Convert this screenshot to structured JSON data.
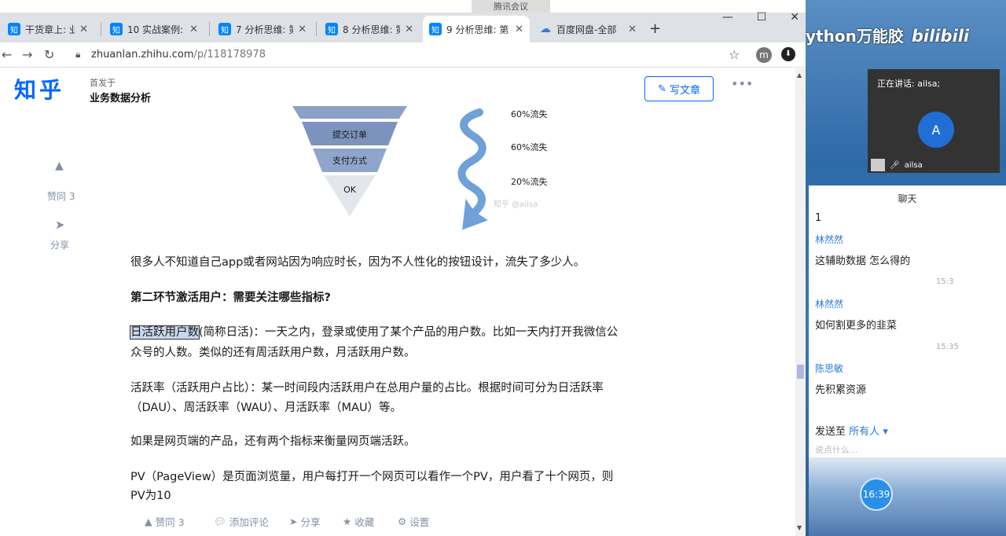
{
  "meeting": {
    "window_title": "腾讯会议"
  },
  "watermark": {
    "brand_left": "Python万能胶",
    "brand_right": "bilibili"
  },
  "tabs": [
    {
      "favicon": "知",
      "title": "干货章上: 业"
    },
    {
      "favicon": "知",
      "title": "10 实战案例:"
    },
    {
      "favicon": "知",
      "title": "7 分析思维: 第"
    },
    {
      "favicon": "知",
      "title": "8 分析思维: 第"
    },
    {
      "favicon": "知",
      "title": "9 分析思维: 第"
    },
    {
      "favicon": "cloud",
      "title": "百度网盘-全部"
    }
  ],
  "browser": {
    "url_host": "zhuanlan.zhihu.com",
    "url_path": "/p/118178978",
    "profile_initial": "m"
  },
  "page": {
    "logo": "知乎",
    "pub_label": "首发于",
    "pub_name": "业务数据分析",
    "write_label": "写文章",
    "side_like": "赞同 3",
    "side_share": "分享",
    "funnel": {
      "levels": [
        "提交订单",
        "支付方式",
        "OK"
      ],
      "losses": [
        "60%流失",
        "60%流失",
        "20%流失"
      ],
      "watermark": "知乎 @ailsa"
    },
    "paragraphs": {
      "p1": "很多人不知道自己app或者网站因为响应时长，因为不人性化的按钮设计，流失了多少人。",
      "h2": "第二环节激活用户：需要关注哪些指标?",
      "p2_hl": "日活跃用户数",
      "p2_a": "(简称日活)：一天之内，登录或使用了某个产品的用户数。比如一天内打开我微信公",
      "p2_b": "众号的人数。类似的还有周活跃用户数，月活跃用户数。",
      "p3_a": "活跃率（活跃用户占比）：某一时间段内活跃用户在总用户量的占比。根据时间可分为日活跃率",
      "p3_b": "（DAU）、周活跃率（WAU）、月活跃率（MAU）等。",
      "p4": "如果是网页端的产品，还有两个指标来衡量网页端活跃。",
      "p5_a": "PV（PageView）是页面浏览量，用户每打开一个网页可以看作一个PV，用户看了十个网页，则",
      "p5_b": "PV为10"
    },
    "bottom": {
      "like": "赞同 3",
      "comment": "添加评论",
      "share": "分享",
      "fav": "收藏",
      "settings": "设置"
    }
  },
  "meet": {
    "speaking": "正在讲话: ailsa;",
    "avatar": "A",
    "speaker": "ailsa",
    "chat_title": "聊天",
    "messages": [
      {
        "name": "",
        "body": "1",
        "time": ""
      },
      {
        "name": "林然然",
        "body": "这辅助数据 怎么得的",
        "time": "15:3"
      },
      {
        "name": "林然然",
        "body": "如何割更多的韭菜",
        "time": "15:35"
      },
      {
        "name": "陈思敏",
        "body": "先积累资源",
        "time": ""
      }
    ],
    "send_to_label": "发送至",
    "send_to_target": "所有人",
    "input_placeholder": "说点什么...",
    "timer": "16:39"
  }
}
